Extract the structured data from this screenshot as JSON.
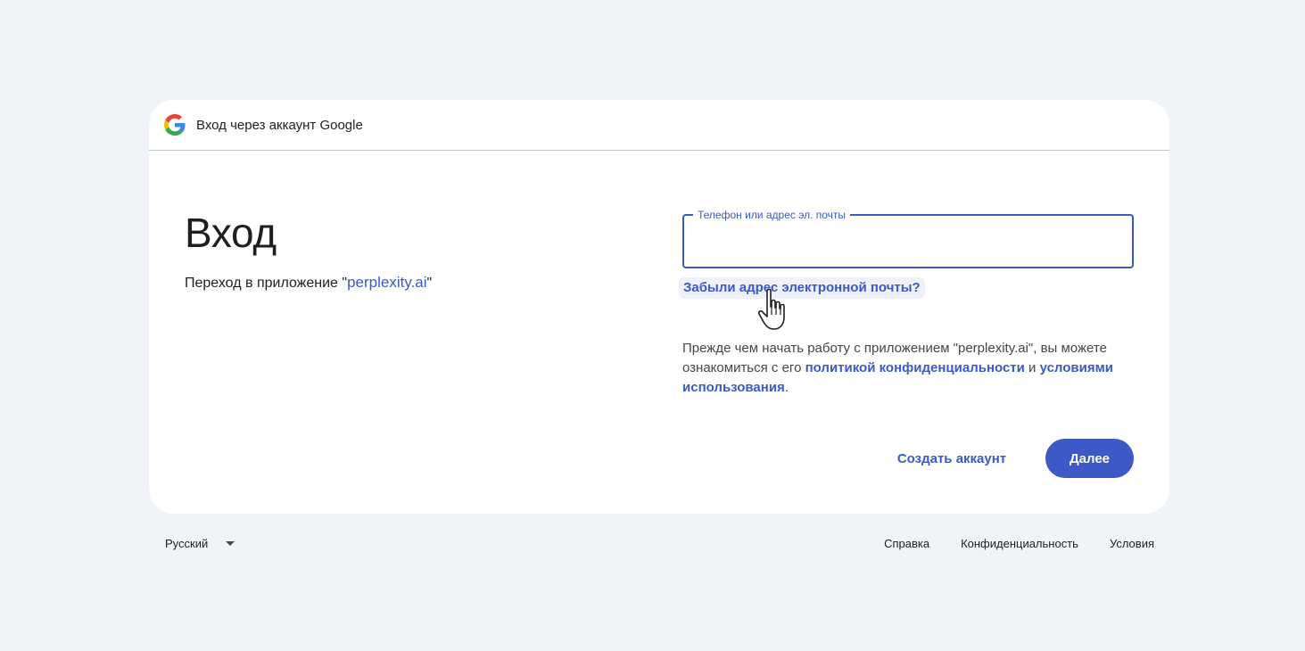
{
  "header": {
    "title": "Вход через аккаунт Google",
    "logo_icon": "google-g-icon"
  },
  "main": {
    "title": "Вход",
    "subtitle_prefix": "Переход в приложение \"",
    "app_name": "perplexity.ai",
    "subtitle_suffix": "\""
  },
  "form": {
    "field_label": "Телефон или адрес эл. почты",
    "field_value": "",
    "forgot_link": "Забыли адрес электронной почты?"
  },
  "notice": {
    "text_before": "Прежде чем начать работу с приложением \"perplexity.ai\", вы можете ознакомиться с его ",
    "privacy_link": "политикой конфиденциальности",
    "and": " и ",
    "terms_link": "условиями использования",
    "end": "."
  },
  "actions": {
    "create_account": "Создать аккаунт",
    "next": "Далее"
  },
  "footer": {
    "language": "Русский",
    "help": "Справка",
    "privacy": "Конфиденциальность",
    "terms": "Условия"
  },
  "colors": {
    "accent": "#3c59c6",
    "background": "#f0f4f9",
    "card": "#ffffff"
  }
}
